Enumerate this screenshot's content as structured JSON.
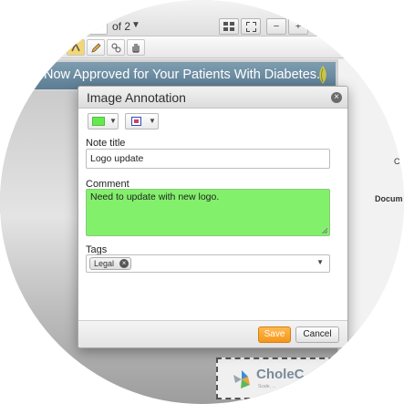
{
  "toolbar": {
    "page_of": "of 2",
    "icons": [
      "chevron-down-icon",
      "thumbnails-icon",
      "fit-page-icon",
      "zoom-out-icon",
      "zoom-in-icon"
    ]
  },
  "tools": {
    "icons": [
      "text-annotation-icon",
      "pencil-icon",
      "link-icon",
      "hand-pan-icon"
    ]
  },
  "document": {
    "banner_text": "Now Approved for Your Patients With Diabetes.",
    "side_panel_c": "C",
    "side_panel_doc": "Docum",
    "stamp_name": "CholeC",
    "stamp_sub": "Scale, ..."
  },
  "dialog": {
    "title": "Image Annotation",
    "color_value": "#66e84f",
    "note_title_label": "Note title",
    "note_title_value": "Logo update",
    "comment_label": "Comment",
    "comment_value": "Need to update with new logo.",
    "tags_label": "Tags",
    "tags": [
      "Legal"
    ],
    "save_label": "Save",
    "cancel_label": "Cancel"
  },
  "colors": {
    "accent_save": "#f5961a",
    "annotation_green": "#83f06c",
    "banner": "#6a8aa1"
  }
}
